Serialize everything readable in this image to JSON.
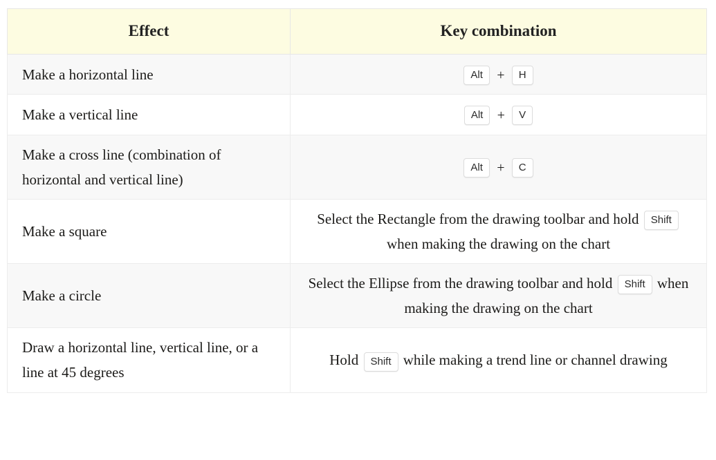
{
  "table": {
    "headers": {
      "effect": "Effect",
      "key_combination": "Key combination"
    },
    "rows": [
      {
        "effect": "Make a horizontal line",
        "keys": {
          "type": "combo",
          "pre_text": "",
          "key1": "Alt",
          "separator": "+",
          "key2": "H",
          "post_text": ""
        }
      },
      {
        "effect": "Make a vertical line",
        "keys": {
          "type": "combo",
          "pre_text": "",
          "key1": "Alt",
          "separator": "+",
          "key2": "V",
          "post_text": ""
        }
      },
      {
        "effect": "Make a cross line (combination of horizontal and vertical line)",
        "keys": {
          "type": "combo",
          "pre_text": "",
          "key1": "Alt",
          "separator": "+",
          "key2": "C",
          "post_text": ""
        }
      },
      {
        "effect": "Make a square",
        "keys": {
          "type": "sentence",
          "pre_text": "Select the Rectangle from the drawing toolbar and hold",
          "key1": "Shift",
          "post_text": "when making the drawing on the chart"
        }
      },
      {
        "effect": "Make a circle",
        "keys": {
          "type": "sentence",
          "pre_text": "Select the Ellipse from the drawing toolbar and hold",
          "key1": "Shift",
          "post_text": "when making the drawing on the chart"
        }
      },
      {
        "effect": "Draw a horizontal line, vertical line, or a line at 45 degrees",
        "keys": {
          "type": "sentence",
          "pre_text": "Hold",
          "key1": "Shift",
          "post_text": "while making a trend line or channel drawing"
        }
      }
    ]
  },
  "colors": {
    "header_background": "#fdfce1",
    "stripe_background": "#f8f8f8",
    "row_background": "#ffffff",
    "border": "#ececec",
    "text": "#1c1b19",
    "header_text": "#222222",
    "kbd_border": "#dcdcdc"
  }
}
